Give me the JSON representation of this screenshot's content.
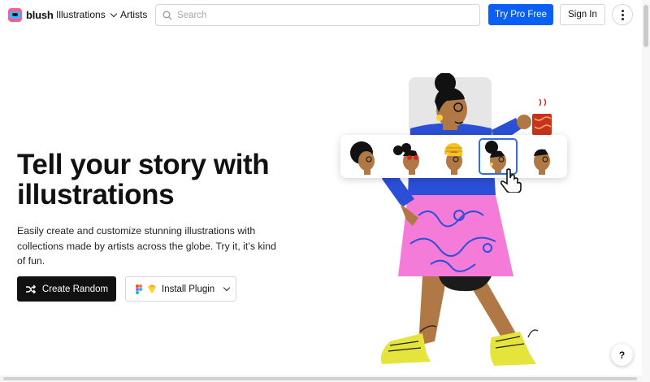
{
  "nav": {
    "brand": "blush",
    "links": [
      {
        "label": "Illustrations",
        "has_dropdown": true
      },
      {
        "label": "Artists",
        "has_dropdown": false
      }
    ],
    "search": {
      "placeholder": "Search",
      "value": ""
    },
    "try_pro_label": "Try Pro Free",
    "sign_in_label": "Sign In",
    "more_icon": "kebab-icon"
  },
  "hero": {
    "title": "Tell your story with\nillustrations",
    "subtitle": "Easily create and customize stunning illustrations with collections made by artists across the globe. Try it, it’s kind of fun.",
    "create_random_label": "Create Random",
    "install_plugin_label": "Install Plugin",
    "create_random_icon": "shuffle-icon",
    "plugin_icons": [
      "figma-icon",
      "sketch-icon"
    ]
  },
  "variant_picker": {
    "selected_index": 3,
    "count": 5
  },
  "help_label": "?",
  "colors": {
    "accent": "#0a60f5",
    "dark_button": "#111111",
    "skirt_pink": "#f47bd8",
    "shirt_blue": "#2b4fd6",
    "shoe_yellow": "#e4e43c",
    "skin": "#b07844"
  }
}
